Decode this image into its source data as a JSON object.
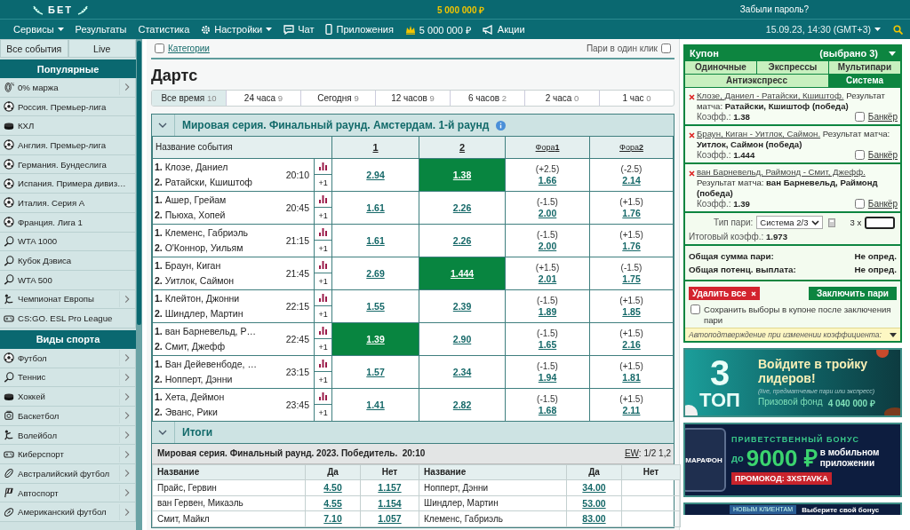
{
  "header": {
    "logo": "БЕТ",
    "jackpot": "5 000 000 ₽",
    "forgot_password": "Забыли пароль?"
  },
  "nav": {
    "items": [
      {
        "label": "Сервисы",
        "kind": "plain",
        "dropdown": true
      },
      {
        "label": "Результаты",
        "kind": "plain",
        "dropdown": false
      },
      {
        "label": "Статистика",
        "kind": "plain",
        "dropdown": false
      },
      {
        "label": "Настройки",
        "kind": "settings",
        "dropdown": true
      },
      {
        "label": "Чат",
        "kind": "chat",
        "dropdown": false
      },
      {
        "label": "Приложения",
        "kind": "apps",
        "dropdown": false
      },
      {
        "label": "5 000 000 ₽",
        "kind": "jackpot",
        "dropdown": false
      },
      {
        "label": "Акции",
        "kind": "promo",
        "dropdown": false
      }
    ],
    "datetime": "15.09.23, 14:30 (GMT+3)"
  },
  "sidebar": {
    "tabs": [
      {
        "label": "Все события"
      },
      {
        "label": "Live"
      }
    ],
    "sections": [
      {
        "title": "Популярные",
        "items": [
          {
            "label": "0% маржа",
            "kind": "margin",
            "submenu": true
          },
          {
            "label": "Россия. Премьер-лига",
            "kind": "soccer",
            "submenu": false
          },
          {
            "label": "КХЛ",
            "kind": "hockey",
            "submenu": false
          },
          {
            "label": "Англия. Премьер-лига",
            "kind": "soccer",
            "submenu": false
          },
          {
            "label": "Германия. Бундеслига",
            "kind": "soccer",
            "submenu": false
          },
          {
            "label": "Испания. Примера дивиз…",
            "kind": "soccer",
            "submenu": false
          },
          {
            "label": "Италия. Серия А",
            "kind": "soccer",
            "submenu": false
          },
          {
            "label": "Франция. Лига 1",
            "kind": "soccer",
            "submenu": false
          },
          {
            "label": "WTA 1000",
            "kind": "tennis",
            "submenu": false
          },
          {
            "label": "Кубок Дэвиса",
            "kind": "tennis",
            "submenu": false
          },
          {
            "label": "WTA 500",
            "kind": "tennis",
            "submenu": false
          },
          {
            "label": "Чемпионат Европы",
            "kind": "figure",
            "submenu": true
          },
          {
            "label": "CS:GO. ESL Pro League",
            "kind": "esports",
            "submenu": false
          }
        ]
      },
      {
        "title": "Виды спорта",
        "items": [
          {
            "label": "Футбол",
            "kind": "soccer",
            "submenu": true
          },
          {
            "label": "Теннис",
            "kind": "tennis",
            "submenu": true
          },
          {
            "label": "Хоккей",
            "kind": "hockey",
            "submenu": true
          },
          {
            "label": "Баскетбол",
            "kind": "basketball",
            "submenu": true
          },
          {
            "label": "Волейбол",
            "kind": "figure",
            "submenu": true
          },
          {
            "label": "Киберспорт",
            "kind": "esports",
            "submenu": true
          },
          {
            "label": "Австралийский футбол",
            "kind": "rugby",
            "submenu": true
          },
          {
            "label": "Автоспорт",
            "kind": "motorsport",
            "submenu": true
          },
          {
            "label": "Американский футбол",
            "kind": "amfootball",
            "submenu": true
          }
        ]
      }
    ]
  },
  "content": {
    "categories": {
      "label": "Категории",
      "checked": false
    },
    "one_click": {
      "label": "Пари в один клик",
      "checked": false
    },
    "title": "Дартс",
    "periods": [
      {
        "label": "Все время",
        "count": "10",
        "selected": true
      },
      {
        "label": "24 часа",
        "count": "9",
        "selected": false
      },
      {
        "label": "Сегодня",
        "count": "9",
        "selected": false
      },
      {
        "label": "12 часов",
        "count": "9",
        "selected": false
      },
      {
        "label": "6 часов",
        "count": "2",
        "selected": false
      },
      {
        "label": "2 часа",
        "count": "0",
        "selected": false
      },
      {
        "label": "1 час",
        "count": "0",
        "selected": false
      }
    ],
    "group": {
      "title": "Мировая серия. Финальный раунд. Амстердам. 1-й раунд",
      "expanded": true,
      "columns": [
        "Название события",
        "1",
        "2",
        "Фора**1**",
        "Фора**2**"
      ],
      "events": [
        {
          "players": [
            "**1.** Клозе, Даниел",
            "**2.** Ратайски, Кшиштоф"
          ],
          "time": "20:10",
          "more": "+1",
          "odds": [
            {
              "value": "2.94",
              "selected": false
            },
            {
              "value": "1.38",
              "selected": true
            }
          ],
          "handicaps": [
            {
              "line": "(+2.5)",
              "value": "1.66",
              "selected": false
            },
            {
              "line": "(-2.5)",
              "value": "2.14",
              "selected": false
            }
          ]
        },
        {
          "players": [
            "**1.** Ашер, Грейам",
            "**2.** Пьюха, Хопей"
          ],
          "time": "20:45",
          "more": "+1",
          "odds": [
            {
              "value": "1.61",
              "selected": false
            },
            {
              "value": "2.26",
              "selected": false
            }
          ],
          "handicaps": [
            {
              "line": "(-1.5)",
              "value": "2.00",
              "selected": false
            },
            {
              "line": "(+1.5)",
              "value": "1.76",
              "selected": false
            }
          ]
        },
        {
          "players": [
            "**1.** Клеменс, Габриэль",
            "**2.** О'Коннор, Уильям"
          ],
          "time": "21:15",
          "more": "+1",
          "odds": [
            {
              "value": "1.61",
              "selected": false
            },
            {
              "value": "2.26",
              "selected": false
            }
          ],
          "handicaps": [
            {
              "line": "(-1.5)",
              "value": "2.00",
              "selected": false
            },
            {
              "line": "(+1.5)",
              "value": "1.76",
              "selected": false
            }
          ]
        },
        {
          "players": [
            "**1.** Браун, Киган",
            "**2.** Уитлок, Саймон"
          ],
          "time": "21:45",
          "more": "+1",
          "odds": [
            {
              "value": "2.69",
              "selected": false
            },
            {
              "value": "1.444",
              "selected": true
            }
          ],
          "handicaps": [
            {
              "line": "(+1.5)",
              "value": "2.01",
              "selected": false
            },
            {
              "line": "(-1.5)",
              "value": "1.75",
              "selected": false
            }
          ]
        },
        {
          "players": [
            "**1.** Клейтон, Джонни",
            "**2.** Шиндлер, Мартин"
          ],
          "time": "22:15",
          "more": "+1",
          "odds": [
            {
              "value": "1.55",
              "selected": false
            },
            {
              "value": "2.39",
              "selected": false
            }
          ],
          "handicaps": [
            {
              "line": "(-1.5)",
              "value": "1.89",
              "selected": false
            },
            {
              "line": "(+1.5)",
              "value": "1.85",
              "selected": false
            }
          ]
        },
        {
          "players": [
            "**1.** ван Барневельд, Р…",
            "**2.** Смит, Джефф"
          ],
          "time": "22:45",
          "more": "+1",
          "odds": [
            {
              "value": "1.39",
              "selected": true
            },
            {
              "value": "2.90",
              "selected": false
            }
          ],
          "handicaps": [
            {
              "line": "(-1.5)",
              "value": "1.65",
              "selected": false
            },
            {
              "line": "(+1.5)",
              "value": "2.16",
              "selected": false
            }
          ]
        },
        {
          "players": [
            "**1.** Ван Дейевенбоде, …",
            "**2.** Нопперт, Дэнни"
          ],
          "time": "23:15",
          "more": "+1",
          "odds": [
            {
              "value": "1.57",
              "selected": false
            },
            {
              "value": "2.34",
              "selected": false
            }
          ],
          "handicaps": [
            {
              "line": "(-1.5)",
              "value": "1.94",
              "selected": false
            },
            {
              "line": "(+1.5)",
              "value": "1.81",
              "selected": false
            }
          ]
        },
        {
          "players": [
            "**1.** Хета, Деймон",
            "**2.** Эванс, Рики"
          ],
          "time": "23:45",
          "more": "+1",
          "odds": [
            {
              "value": "1.41",
              "selected": false
            },
            {
              "value": "2.82",
              "selected": false
            }
          ],
          "handicaps": [
            {
              "line": "(-1.5)",
              "value": "1.68",
              "selected": false
            },
            {
              "line": "(+1.5)",
              "value": "2.11",
              "selected": false
            }
          ]
        }
      ]
    },
    "totals": {
      "title": "Итоги",
      "expanded": true,
      "market": "Мировая серия. Финальный раунд. 2023. Победитель.  20:10",
      "ew_link": "EW",
      "ew_terms": ": 1/2 1,2",
      "columns": [
        "Название",
        "Да",
        "Нет",
        "Название",
        "Да",
        "Нет"
      ],
      "rows": [
        {
          "name1": "Прайс, Гервин",
          "yes1": "4.50",
          "no1": "1.157",
          "name2": "Нопперт, Дэнни",
          "yes2": "34.00"
        },
        {
          "name1": "ван Гервен, Микаэль",
          "yes1": "4.55",
          "no1": "1.154",
          "name2": "Шиндлер, Мартин",
          "yes2": "53.00"
        },
        {
          "name1": "Смит, Майкл",
          "yes1": "7.10",
          "no1": "1.057",
          "name2": "Клеменс, Габриэль",
          "yes2": "83.00"
        }
      ]
    }
  },
  "coupon": {
    "title": "Купон",
    "count": "(выбрано 3)",
    "tabs": [
      {
        "label": "Одиночные",
        "selected": false
      },
      {
        "label": "Экспрессы",
        "selected": false
      },
      {
        "label": "Мультипари",
        "selected": false
      },
      {
        "label": "Антиэкспресс",
        "selected": false
      },
      {
        "label": "Система",
        "selected": true
      }
    ],
    "bets": [
      {
        "event": "Клозе, Даниел - Ратайски, Кшиштоф.",
        "market": "Результат матча:",
        "pick": "Ратайски, Кшиштоф (победа)",
        "odds_label": "Коэфф.:",
        "odds": "1.38",
        "banker": "Банкёр",
        "banker_checked": false
      },
      {
        "event": "Браун, Киган - Уитлок, Саймон.",
        "market": "Результат матча:",
        "pick": "Уитлок, Саймон (победа)",
        "odds_label": "Коэфф.:",
        "odds": "1.444",
        "banker": "Банкёр",
        "banker_checked": false
      },
      {
        "event": "ван Барневельд, Раймонд - Смит, Джефф.",
        "market": "Результат матча:",
        "pick": "ван Барневельд, Раймонд (победа)",
        "odds_label": "Коэфф.:",
        "odds": "1.39",
        "banker": "Банкёр",
        "banker_checked": false
      }
    ],
    "system": {
      "type_label": "Тип пари:",
      "type": "Система 2/3",
      "multiplier": "3 x",
      "total_label": "Итоговый коэфф.:",
      "total": "1.973"
    },
    "summary": [
      {
        "label": "Общая сумма пари:",
        "value": "Не опред."
      },
      {
        "label": "Общая потенц. выплата:",
        "value": "Не опред."
      }
    ],
    "delete_button": "Удалить все",
    "submit_button": "Заключить пари",
    "save_choices": {
      "label": "Сохранить выборы в купоне после заключения пари",
      "checked": false
    },
    "auto_confirm": "Автоподтверждение при изменении коэффициента:"
  },
  "banners": {
    "top3": {
      "digit": "3",
      "word": "ТОП",
      "headline": "Войдите в тройку лидеров!",
      "note": "(live, предматчевые пари или экспресс)",
      "fund_label": "Призовой фонд",
      "fund": "4 040 000 ₽"
    },
    "bonus": {
      "phone_text": "МАРАФОН",
      "kicker": "ПРИВЕТСТВЕННЫЙ БОНУС",
      "prefix": "до",
      "amount": "9000 ₽",
      "suffix": "в мобильном приложении",
      "promo": "ПРОМОКОД: 3XSTAVKA"
    },
    "newclient": {
      "badge": "НОВЫМ КЛИЕНТАМ",
      "text": "Выберите свой бонус"
    }
  }
}
